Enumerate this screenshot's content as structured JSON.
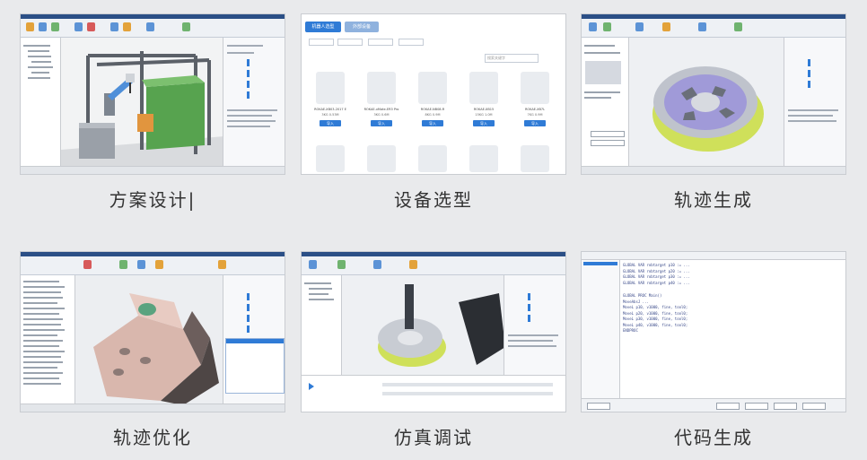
{
  "cards": [
    {
      "caption": "方案设计|"
    },
    {
      "caption": "设备选型"
    },
    {
      "caption": "轨迹生成"
    },
    {
      "caption": "轨迹优化"
    },
    {
      "caption": "仿真调试"
    },
    {
      "caption": "代码生成"
    }
  ],
  "selection": {
    "tabs": [
      "机器人选型",
      "外部设备"
    ],
    "search_placeholder": "搜索关键字",
    "robots": [
      {
        "name": "ROKAE-XB03-2017 E",
        "spec": "3KG 0.53M",
        "btn": "导入"
      },
      {
        "name": "ROKAE-xMate-ER3 Pro",
        "spec": "3KG 0.6M",
        "btn": "导入"
      },
      {
        "name": "ROKAE-NB08-R",
        "spec": "8KG 0.9M",
        "btn": "导入"
      },
      {
        "name": "ROKAE-XB15",
        "spec": "15KG 1.0M",
        "btn": "导入"
      },
      {
        "name": "ROKAE-XB7L",
        "spec": "7KG 0.9M",
        "btn": "导入"
      }
    ]
  },
  "code": {
    "header": "GLOBAL PROC Main()",
    "lines": [
      "GLOBAL VAR robtarget p10 := ...",
      "GLOBAL VAR robtarget p20 := ...",
      "GLOBAL VAR robtarget p30 := ...",
      "GLOBAL VAR robtarget p40 := ...",
      "GLOBAL PROC Main()",
      "  MoveAbsJ ...",
      "  MoveL p10, v1000, fine, tool0;",
      "  MoveL p20, v1000, fine, tool0;",
      "  MoveL p30, v1000, fine, tool0;",
      "  MoveL p40, v1000, fine, tool0;",
      "ENDPROC"
    ]
  },
  "colors": {
    "brand_blue": "#2f7bd6",
    "frame": "#c9ccd1",
    "bg": "#e9eaec",
    "caption": "#333333"
  }
}
